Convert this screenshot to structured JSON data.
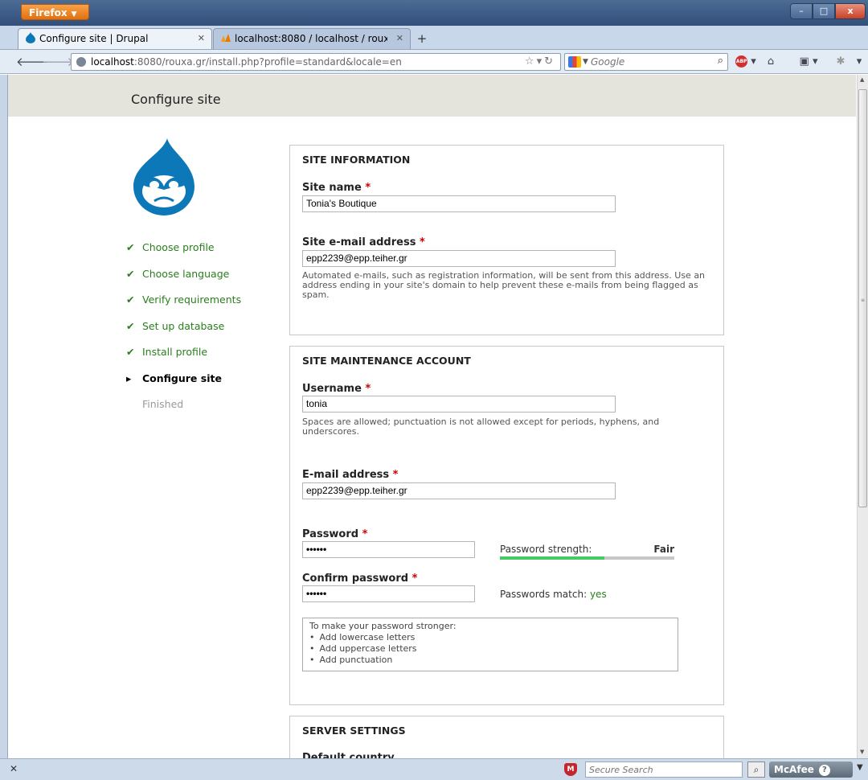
{
  "browser": {
    "menu_label": "Firefox",
    "window_controls": {
      "minimize": "–",
      "maximize": "□",
      "close": "x"
    },
    "tabs": [
      {
        "title": "Configure site | Drupal",
        "active": true
      },
      {
        "title": "localhost:8080 / localhost / rouxagr | ...",
        "active": false
      }
    ],
    "new_tab": "+",
    "url": {
      "host": "localhost",
      "rest": ":8080/rouxa.gr/install.php?profile=standard&locale=en"
    },
    "search": {
      "engine": "Google",
      "placeholder": "Google"
    }
  },
  "page": {
    "title": "Configure site",
    "steps": [
      {
        "label": "Choose profile",
        "state": "done"
      },
      {
        "label": "Choose language",
        "state": "done"
      },
      {
        "label": "Verify requirements",
        "state": "done"
      },
      {
        "label": "Set up database",
        "state": "done"
      },
      {
        "label": "Install profile",
        "state": "done"
      },
      {
        "label": "Configure site",
        "state": "current"
      },
      {
        "label": "Finished",
        "state": "pending"
      }
    ],
    "site_information": {
      "legend": "SITE INFORMATION",
      "site_name_label": "Site name",
      "site_name_value": "Tonia's Boutique",
      "site_email_label": "Site e-mail address",
      "site_email_value": "epp2239@epp.teiher.gr",
      "site_email_desc": "Automated e-mails, such as registration information, will be sent from this address. Use an address ending in your site's domain to help prevent these e-mails from being flagged as spam."
    },
    "maintenance_account": {
      "legend": "SITE MAINTENANCE ACCOUNT",
      "username_label": "Username",
      "username_value": "tonia",
      "username_desc": "Spaces are allowed; punctuation is not allowed except for periods, hyphens, and underscores.",
      "email_label": "E-mail address",
      "email_value": "epp2239@epp.teiher.gr",
      "password_label": "Password",
      "password_value": "••••••",
      "confirm_label": "Confirm password",
      "confirm_value": "••••••",
      "strength_label": "Password strength:",
      "strength_value": "Fair",
      "strength_fraction": 0.6,
      "match_label": "Passwords match:",
      "match_value": "yes",
      "tips_title": "To make your password stronger:",
      "tips": [
        "Add lowercase letters",
        "Add uppercase letters",
        "Add punctuation"
      ]
    },
    "server_settings": {
      "legend": "SERVER SETTINGS",
      "default_country_label": "Default country"
    },
    "required_mark": "*"
  },
  "statusbar": {
    "secure_search_placeholder": "Secure Search",
    "mcafee_label": "McAfee"
  },
  "colors": {
    "done_step": "#2a7e1d",
    "required": "#cc0000",
    "strength_fill": "#47c965",
    "drupal_blue": "#0d78b8"
  },
  "icons": {
    "check": "checkmark-icon",
    "current": "triangle-right-icon"
  }
}
